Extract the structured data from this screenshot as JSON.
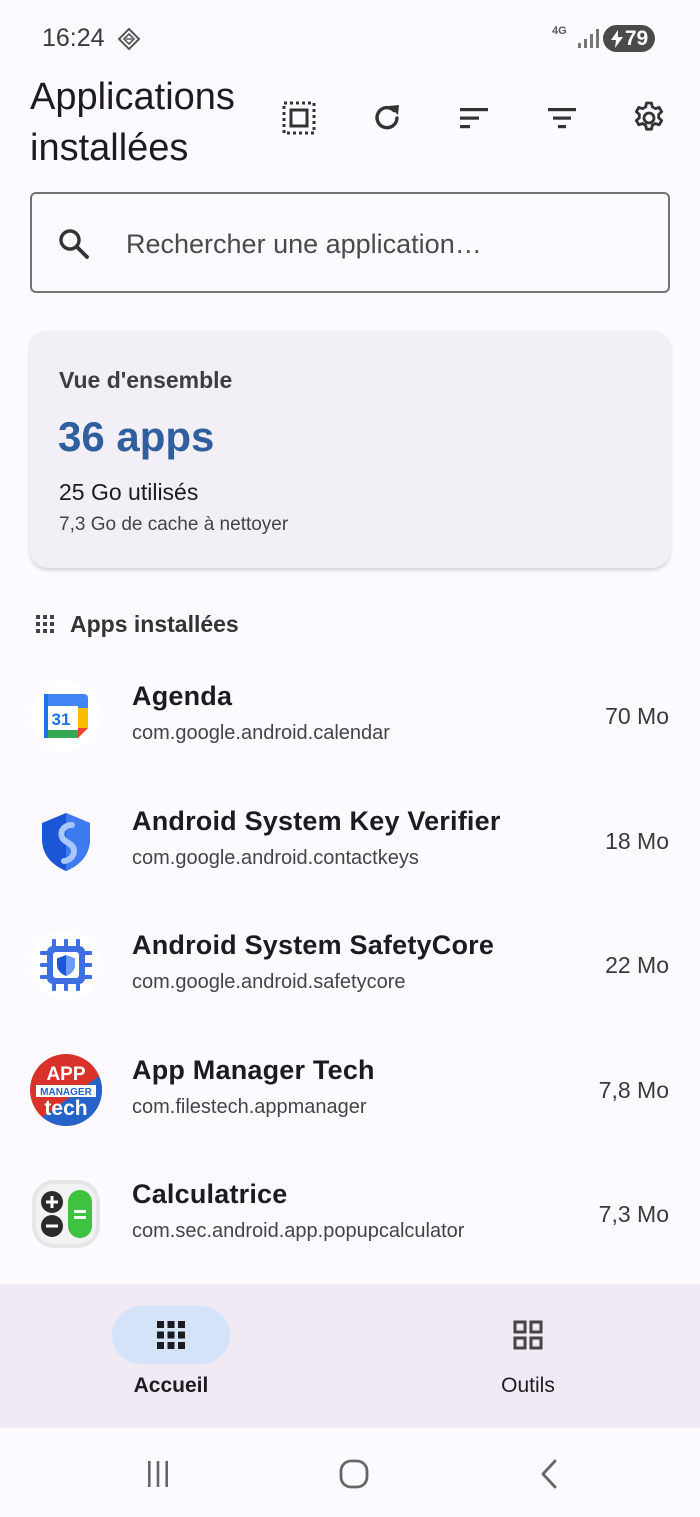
{
  "status_bar": {
    "time": "16:24",
    "network": "4G",
    "battery": "79"
  },
  "header": {
    "title": "Applications installées"
  },
  "toolbar": {
    "icons": [
      "select-all-icon",
      "refresh-icon",
      "sort-icon",
      "filter-icon",
      "gear-icon"
    ]
  },
  "search": {
    "placeholder": "Rechercher une application…"
  },
  "overview": {
    "label": "Vue d'ensemble",
    "count": "36 apps",
    "used": "25 Go utilisés",
    "cache": "7,3 Go de cache à nettoyer"
  },
  "section": {
    "title": "Apps installées"
  },
  "apps": [
    {
      "name": "Agenda",
      "package": "com.google.android.calendar",
      "size": "70 Mo",
      "icon": "calendar-icon"
    },
    {
      "name": "Android System Key Verifier",
      "package": "com.google.android.contactkeys",
      "size": "18 Mo",
      "icon": "shield-icon"
    },
    {
      "name": "Android System SafetyCore",
      "package": "com.google.android.safetycore",
      "size": "22 Mo",
      "icon": "chip-shield-icon"
    },
    {
      "name": "App Manager Tech",
      "package": "com.filestech.appmanager",
      "size": "7,8 Mo",
      "icon": "app-manager-logo",
      "logo_text": [
        "APP",
        "MANAGER",
        "tech"
      ]
    },
    {
      "name": "Calculatrice",
      "package": "com.sec.android.app.popupcalculator",
      "size": "7,3 Mo",
      "icon": "calculator-icon"
    }
  ],
  "calendar_icon_text": "31",
  "bottom_nav": {
    "items": [
      {
        "label": "Accueil",
        "icon": "apps-grid-icon",
        "active": true
      },
      {
        "label": "Outils",
        "icon": "tools-grid-icon",
        "active": false
      }
    ]
  },
  "colors": {
    "accent": "#2f5f9e",
    "nav_active": "#d4e3f8",
    "nav_bg": "#f1e9f4",
    "card_bg": "#f3eff6"
  }
}
